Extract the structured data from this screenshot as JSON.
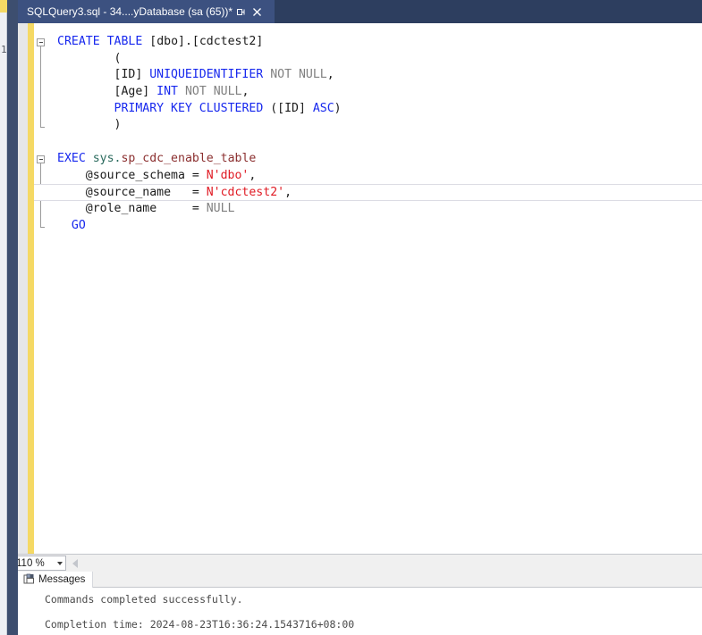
{
  "window": {
    "tab": {
      "title": "SQLQuery3.sql - 34....yDatabase (sa (65))*",
      "pin_icon": "pin-icon",
      "close_icon": "close-icon"
    },
    "left_edge_glyph": "1"
  },
  "editor": {
    "zoom_level": "110 %",
    "lines": [
      {
        "indent": 0,
        "fold": "open",
        "tokens": [
          {
            "t": "CREATE",
            "c": "t-kw"
          },
          {
            "t": " ",
            "c": "t-plain"
          },
          {
            "t": "TABLE",
            "c": "t-kw"
          },
          {
            "t": " ",
            "c": "t-plain"
          },
          {
            "t": "[dbo].[cdctest2]",
            "c": "t-plain"
          }
        ]
      },
      {
        "indent": 1,
        "fold": "none",
        "tokens": [
          {
            "t": "        (",
            "c": "t-plain"
          }
        ]
      },
      {
        "indent": 1,
        "fold": "none",
        "tokens": [
          {
            "t": "        [ID] ",
            "c": "t-plain"
          },
          {
            "t": "UNIQUEIDENTIFIER",
            "c": "t-kw"
          },
          {
            "t": " ",
            "c": "t-plain"
          },
          {
            "t": "NOT NULL",
            "c": "t-gray"
          },
          {
            "t": ",",
            "c": "t-plain"
          }
        ]
      },
      {
        "indent": 1,
        "fold": "none",
        "tokens": [
          {
            "t": "        [Age] ",
            "c": "t-plain"
          },
          {
            "t": "INT",
            "c": "t-kw"
          },
          {
            "t": " ",
            "c": "t-plain"
          },
          {
            "t": "NOT NULL",
            "c": "t-gray"
          },
          {
            "t": ",",
            "c": "t-plain"
          }
        ]
      },
      {
        "indent": 1,
        "fold": "none",
        "tokens": [
          {
            "t": "        ",
            "c": "t-plain"
          },
          {
            "t": "PRIMARY KEY CLUSTERED",
            "c": "t-kw"
          },
          {
            "t": " ([ID] ",
            "c": "t-plain"
          },
          {
            "t": "ASC",
            "c": "t-kw"
          },
          {
            "t": ")",
            "c": "t-plain"
          }
        ]
      },
      {
        "indent": 1,
        "fold": "none",
        "tokens": [
          {
            "t": "        )",
            "c": "t-plain"
          }
        ]
      },
      {
        "indent": 0,
        "fold": "none",
        "tokens": [
          {
            "t": "",
            "c": "t-plain"
          }
        ]
      },
      {
        "indent": 0,
        "fold": "open",
        "tokens": [
          {
            "t": "EXEC",
            "c": "t-kw"
          },
          {
            "t": " ",
            "c": "t-plain"
          },
          {
            "t": "sys.",
            "c": "t-sys"
          },
          {
            "t": "sp_cdc_enable_table",
            "c": "t-proc"
          }
        ]
      },
      {
        "indent": 1,
        "fold": "none",
        "tokens": [
          {
            "t": "    @source_schema = ",
            "c": "t-plain"
          },
          {
            "t": "N'dbo'",
            "c": "t-str"
          },
          {
            "t": ",",
            "c": "t-plain"
          }
        ]
      },
      {
        "indent": 1,
        "fold": "none",
        "current": true,
        "tokens": [
          {
            "t": "    @source_name   = ",
            "c": "t-plain"
          },
          {
            "t": "N'cdctest2'",
            "c": "t-str"
          },
          {
            "t": ",",
            "c": "t-plain"
          }
        ]
      },
      {
        "indent": 1,
        "fold": "none",
        "tokens": [
          {
            "t": "    @role_name     = ",
            "c": "t-plain"
          },
          {
            "t": "NULL",
            "c": "t-gray"
          }
        ]
      },
      {
        "indent": 1,
        "fold": "none",
        "tokens": [
          {
            "t": "  ",
            "c": "t-plain"
          },
          {
            "t": "GO",
            "c": "t-go"
          }
        ]
      }
    ]
  },
  "results": {
    "tabs": [
      {
        "label": "Messages",
        "icon": "messages-grid-icon",
        "active": true
      }
    ],
    "messages": [
      "Commands completed successfully.",
      "",
      "Completion time: 2024-08-23T16:36:24.1543716+08:00"
    ]
  },
  "colors": {
    "tabbar_bg": "#2d3e5f",
    "tab_active_bg": "#3c5180",
    "dock_strip": "#3d4e6f",
    "changebar": "#f5d964",
    "gutter": "#e6e7e8",
    "keyword": "#1728ee",
    "string": "#e01b24",
    "gray_keyword": "#808080",
    "schema": "#2b6b5e",
    "procedure": "#8b2f2f"
  }
}
